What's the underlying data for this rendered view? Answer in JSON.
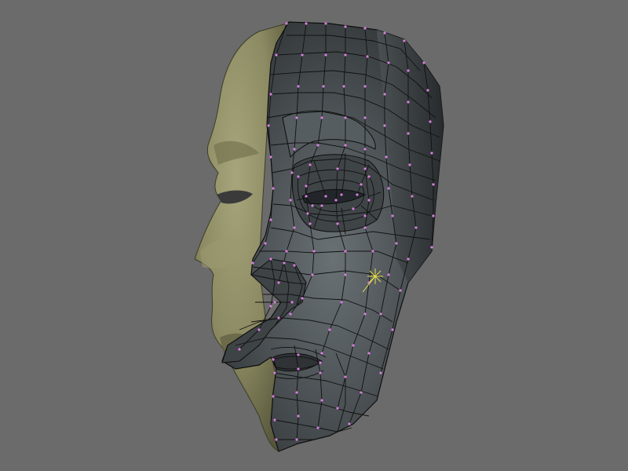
{
  "viewport": {
    "background_color": "#6b6b6b",
    "mesh_object": "head-mesh",
    "shading": "smooth",
    "edit_mode": true
  },
  "colors": {
    "solid_shade": "#8c8c63",
    "solid_highlight": "#a6a47a",
    "solid_shadow": "#4f4f36",
    "edit_face": "#4a4f52",
    "edit_face_light": "#636a6e",
    "edit_face_dark": "#2b2f31",
    "wire": "#111111",
    "vertex": "#d97fe0",
    "cursor": "#e8e04a"
  }
}
